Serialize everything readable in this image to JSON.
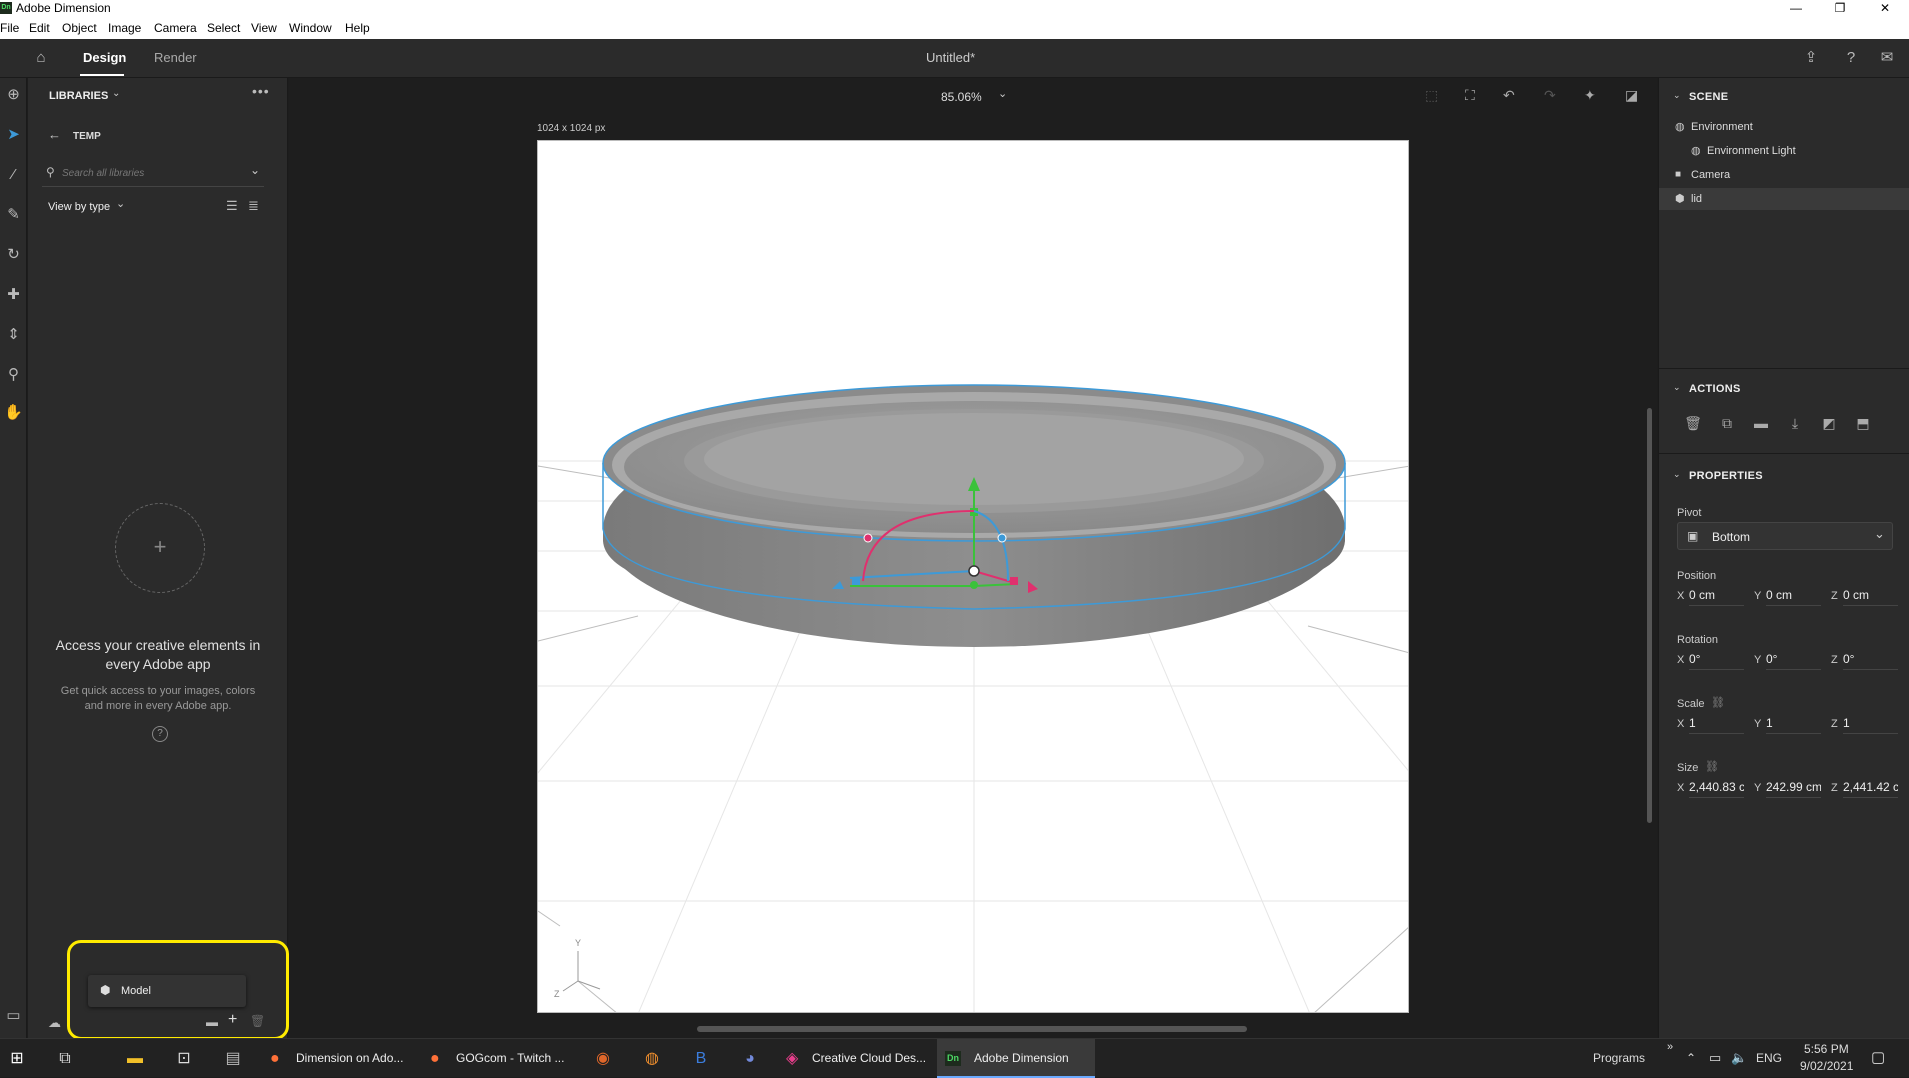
{
  "window": {
    "title": "Adobe Dimension",
    "logo_text": "Dn"
  },
  "menu": [
    "File",
    "Edit",
    "Object",
    "Image",
    "Camera",
    "Select",
    "View",
    "Window",
    "Help"
  ],
  "header": {
    "tabs": [
      "Design",
      "Render"
    ],
    "active_tab": "Design",
    "doc_title": "Untitled*"
  },
  "libraries": {
    "title": "LIBRARIES",
    "back_label": "TEMP",
    "search_placeholder": "Search all libraries",
    "view_by": "View by type",
    "empty_title": "Access your creative elements in every Adobe app",
    "empty_desc": "Get quick access to your images, colors and more in every Adobe app.",
    "model_popup": "Model"
  },
  "canvas": {
    "zoom": "85.06%",
    "size_label": "1024 x 1024 px",
    "axis_y": "Y",
    "axis_z": "Z"
  },
  "scene": {
    "title": "SCENE",
    "items": [
      {
        "label": "Environment",
        "icon": "environment-icon"
      },
      {
        "label": "Environment Light",
        "icon": "light-icon"
      },
      {
        "label": "Camera",
        "icon": "camera-icon"
      },
      {
        "label": "lid",
        "icon": "model-icon",
        "selected": true
      }
    ]
  },
  "actions": {
    "title": "ACTIONS"
  },
  "properties": {
    "title": "PROPERTIES",
    "pivot_label": "Pivot",
    "pivot_value": "Bottom",
    "position_label": "Position",
    "position": {
      "x": "0 cm",
      "y": "0 cm",
      "z": "0 cm"
    },
    "rotation_label": "Rotation",
    "rotation": {
      "x": "0°",
      "y": "0°",
      "z": "0°"
    },
    "scale_label": "Scale",
    "scale": {
      "x": "1",
      "y": "1",
      "z": "1"
    },
    "size_label": "Size",
    "size": {
      "x": "2,440.83 c",
      "y": "242.99 cm",
      "z": "2,441.42 c"
    },
    "axis_x": "X",
    "axis_y": "Y",
    "axis_z": "Z"
  },
  "taskbar": {
    "apps": [
      {
        "label": "Dimension on Ado..."
      },
      {
        "label": "GOGcom - Twitch ..."
      },
      {
        "label": "Creative Cloud Des..."
      },
      {
        "label": "Adobe Dimension",
        "badge": "Dn"
      }
    ],
    "programs": "Programs",
    "lang": "ENG",
    "time": "5:56 PM",
    "date": "9/02/2021"
  },
  "colors": {
    "highlight": "#ffeb00",
    "selection": "#3d9ad8",
    "accent_green": "#3ac23a",
    "accent_pink": "#e0306e"
  }
}
